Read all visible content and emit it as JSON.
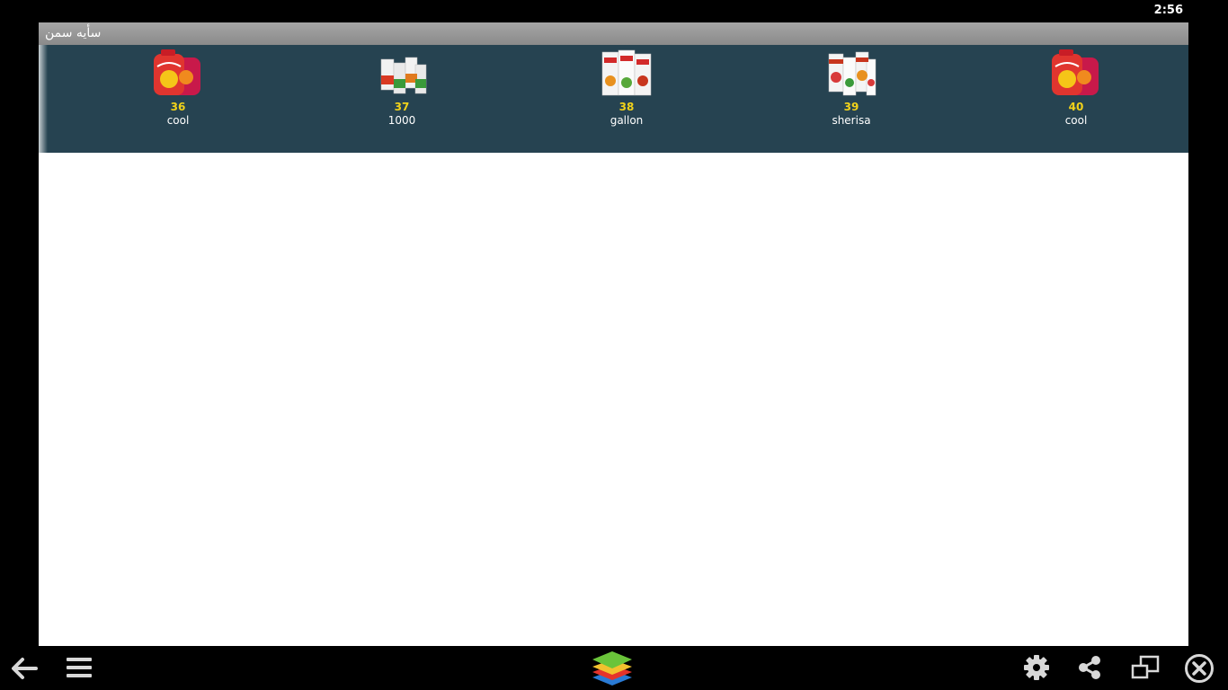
{
  "status": {
    "time": "2:56"
  },
  "app": {
    "title": "سأيه سمن"
  },
  "products": [
    {
      "number": "36",
      "name": "cool",
      "icon": "juice-jug-icon"
    },
    {
      "number": "37",
      "name": "1000",
      "icon": "juice-carton-pack-icon"
    },
    {
      "number": "38",
      "name": "gallon",
      "icon": "juice-carton-pack-icon"
    },
    {
      "number": "39",
      "name": "sherisa",
      "icon": "juice-carton-pack-icon"
    },
    {
      "number": "40",
      "name": "cool",
      "icon": "juice-jug-icon"
    }
  ],
  "nav": {
    "icons": [
      "back-arrow-icon",
      "menu-icon",
      "bluestacks-logo-icon",
      "gear-icon",
      "share-icon",
      "screen-rotate-icon",
      "close-icon"
    ]
  },
  "colors": {
    "strip": "#264351",
    "number": "#f1d21a",
    "title_bar": "#999999"
  }
}
